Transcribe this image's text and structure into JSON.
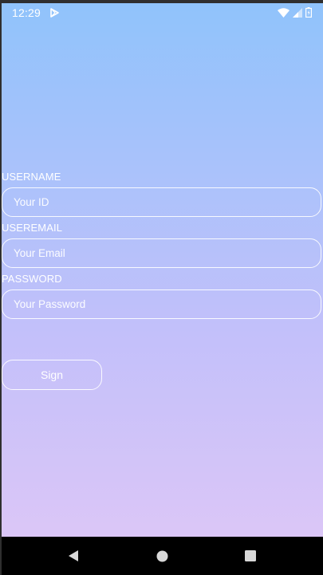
{
  "status_bar": {
    "time": "12:29",
    "icons": [
      "play-store-icon",
      "wifi-icon",
      "signal-icon",
      "battery-icon"
    ]
  },
  "form": {
    "username": {
      "label": "USERNAME",
      "placeholder": "Your ID"
    },
    "useremail": {
      "label": "USEREMAIL",
      "placeholder": "Your Email"
    },
    "password": {
      "label": "PASSWORD",
      "placeholder": "Your Password"
    },
    "sign_label": "Sign"
  },
  "nav_bar": {
    "buttons": [
      "back-icon",
      "home-icon",
      "recents-icon"
    ]
  },
  "colors": {
    "gradient_top": "#90c3fb",
    "gradient_bottom": "#dbc6f7",
    "text": "#ffffff",
    "nav_background": "#000000"
  }
}
